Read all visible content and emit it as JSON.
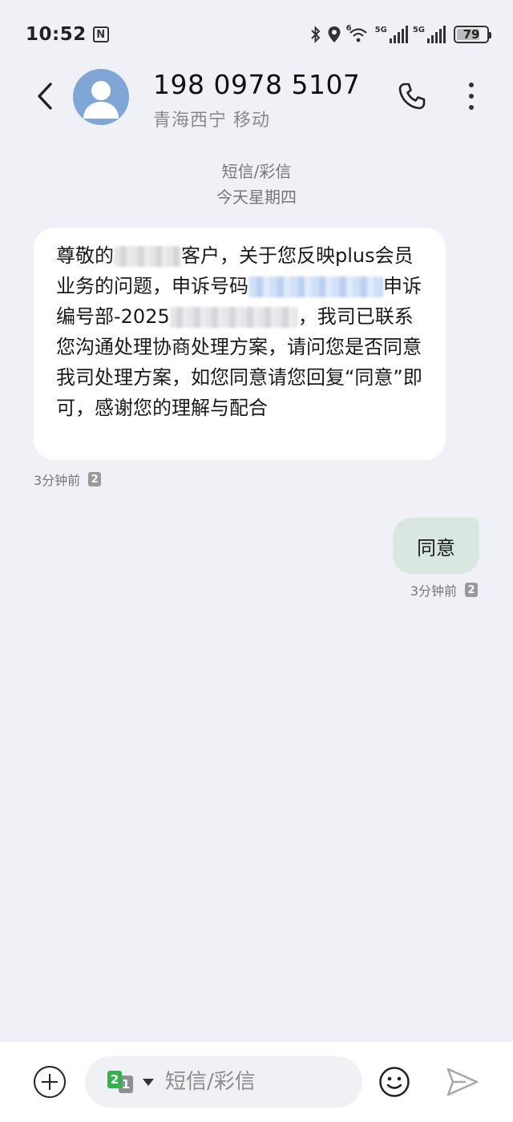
{
  "status_bar": {
    "time": "10:52",
    "nfc_label": "N",
    "signal_1_label": "5G",
    "signal_2_label": "5G",
    "wifi_label": "6",
    "battery_level": "79"
  },
  "header": {
    "contact_number": "198 0978 5107",
    "contact_location": "青海西宁 移动"
  },
  "thread": {
    "type_label": "短信/彩信",
    "date_label": "今天星期四"
  },
  "messages": [
    {
      "direction": "incoming",
      "seg1": "尊敬的",
      "seg2": "客户，关于您反映plus会员业务的问题，申诉号码",
      "seg3": "申诉编号部-2025",
      "seg4": "，我司已联系您沟通处理协商处理方案，请问您是否同意我司处理方案，如您同意请您回复“同意”即可，感谢您的理解与配合",
      "time": "3分钟前",
      "sim": "2"
    },
    {
      "direction": "outgoing",
      "text": "同意",
      "time": "3分钟前",
      "sim": "2"
    }
  ],
  "compose": {
    "sim_primary": "2",
    "sim_secondary": "1",
    "placeholder": "短信/彩信"
  },
  "colors": {
    "background": "#f0f1f7",
    "incoming_bubble": "#ffffff",
    "outgoing_bubble": "#d8e8e0",
    "avatar": "#7fa6d6",
    "sim_active": "#34b24a"
  }
}
